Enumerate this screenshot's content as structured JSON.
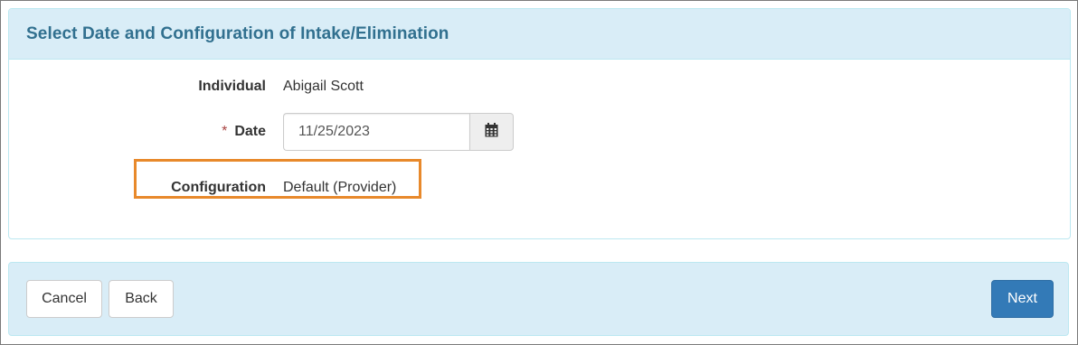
{
  "panel": {
    "title": "Select Date and Configuration of Intake/Elimination"
  },
  "form": {
    "individual": {
      "label": "Individual",
      "value": "Abigail Scott"
    },
    "date": {
      "required_marker": "*",
      "label": "Date",
      "value": "11/25/2023",
      "button_icon": "calendar-icon"
    },
    "configuration": {
      "label": "Configuration",
      "value": "Default (Provider)",
      "highlight_color": "#e8892b"
    }
  },
  "footer": {
    "cancel_label": "Cancel",
    "back_label": "Back",
    "next_label": "Next"
  },
  "colors": {
    "heading_bg": "#d9edf7",
    "heading_text": "#31708f",
    "primary": "#337ab7",
    "required": "#a94442"
  }
}
